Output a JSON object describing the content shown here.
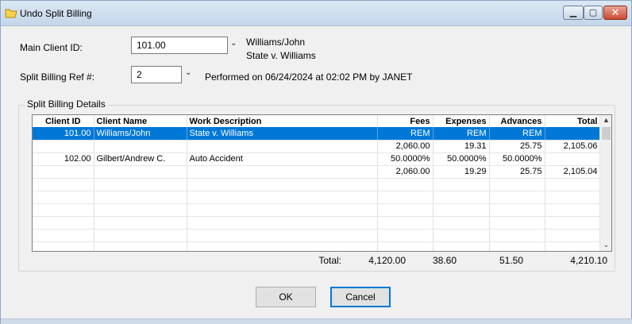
{
  "window": {
    "title": "Undo Split Billing",
    "min_glyph": "▁",
    "max_glyph": "▢",
    "close_glyph": "✕"
  },
  "form": {
    "main_client_label": "Main Client ID:",
    "main_client_value": "101.00",
    "client_name": "Williams/John",
    "client_matter": "State v. Williams",
    "split_ref_label": "Split Billing Ref #:",
    "split_ref_value": "2",
    "performed_text": "Performed on 06/24/2024 at 02:02 PM by JANET",
    "chevron": "⌄"
  },
  "details": {
    "group_title": "Split Billing Details",
    "columns": [
      "Client ID",
      "Client Name",
      "Work Description",
      "Fees",
      "Expenses",
      "Advances",
      "Total"
    ],
    "rows": [
      [
        "101.00",
        "Williams/John",
        "State v. Williams",
        "REM",
        "REM",
        "REM",
        ""
      ],
      [
        "",
        "",
        "",
        "2,060.00",
        "19.31",
        "25.75",
        "2,105.06"
      ],
      [
        "102.00",
        "Gilbert/Andrew C.",
        "Auto Accident",
        "50.0000%",
        "50.0000%",
        "50.0000%",
        ""
      ],
      [
        "",
        "",
        "",
        "2,060.00",
        "19.29",
        "25.75",
        "2,105.04"
      ],
      [
        "",
        "",
        "",
        "",
        "",
        "",
        ""
      ],
      [
        "",
        "",
        "",
        "",
        "",
        "",
        ""
      ],
      [
        "",
        "",
        "",
        "",
        "",
        "",
        ""
      ],
      [
        "",
        "",
        "",
        "",
        "",
        "",
        ""
      ],
      [
        "",
        "",
        "",
        "",
        "",
        "",
        ""
      ],
      [
        "",
        "",
        "",
        "",
        "",
        "",
        ""
      ]
    ],
    "scroll_up": "▲",
    "scroll_down": "⌄"
  },
  "totals": {
    "label": "Total:",
    "fees": "4,120.00",
    "expenses": "38.60",
    "advances": "51.50",
    "total": "4,210.10"
  },
  "buttons": {
    "ok": "OK",
    "cancel": "Cancel"
  }
}
